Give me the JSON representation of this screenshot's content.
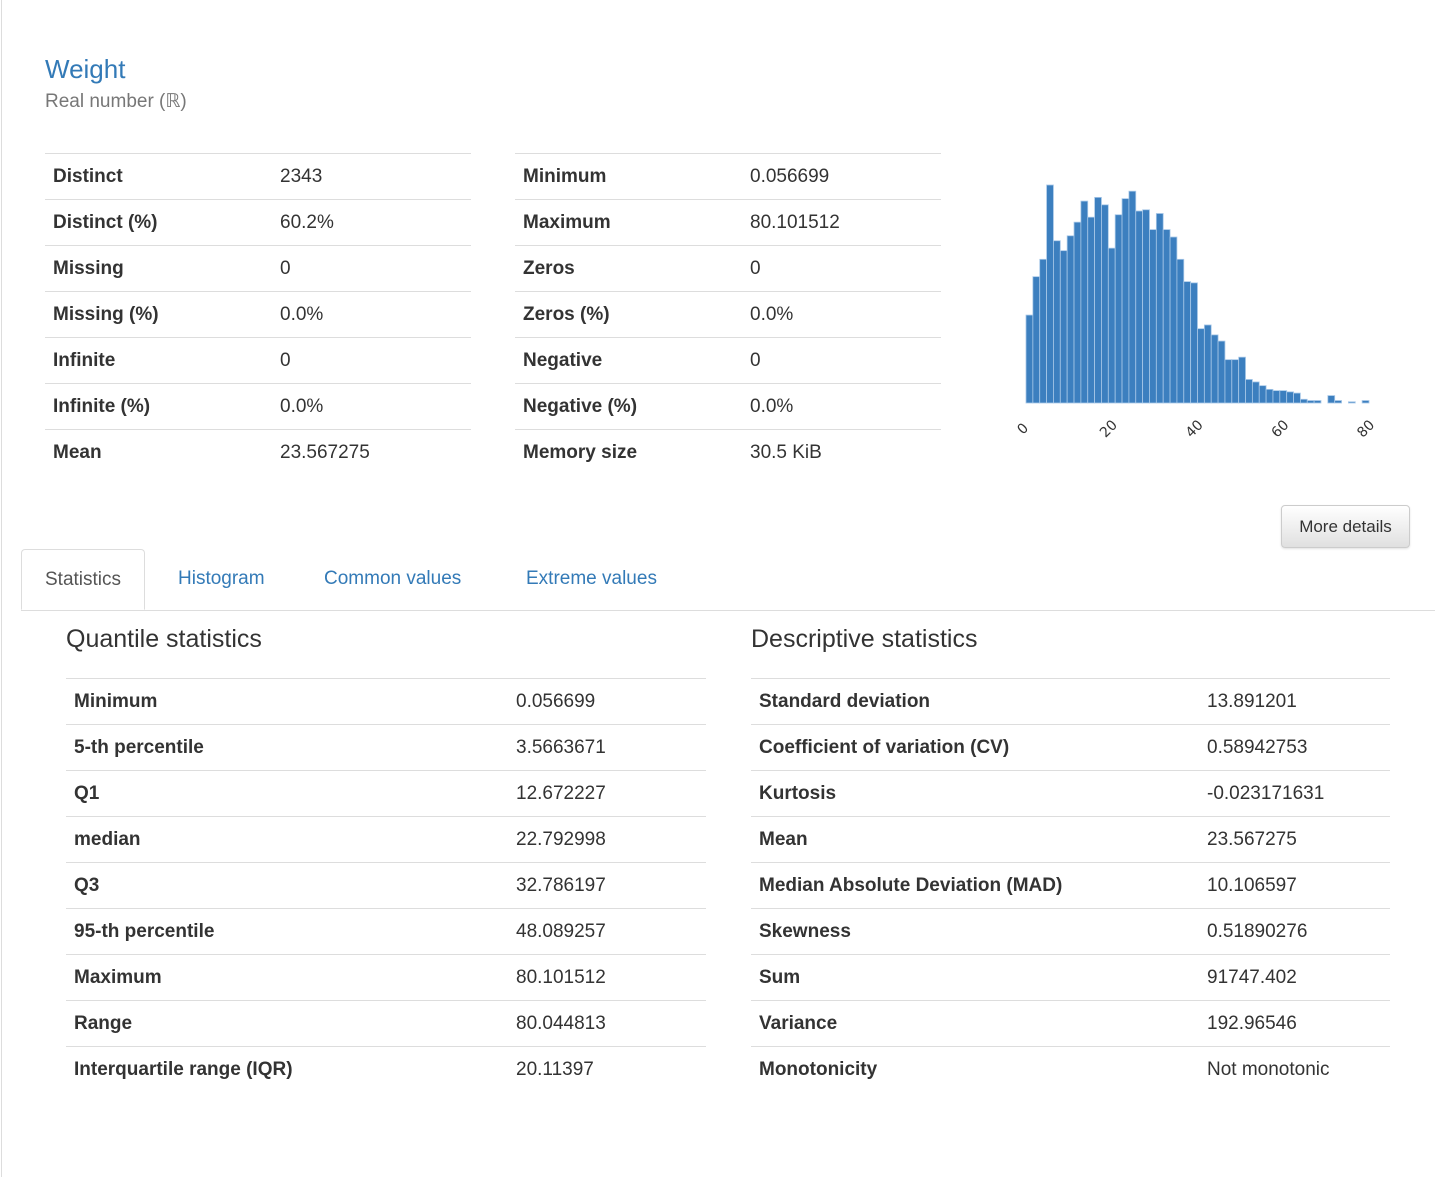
{
  "variable": {
    "name": "Weight",
    "type": "Real number (ℝ)"
  },
  "overview_left": [
    {
      "label": "Distinct",
      "value": "2343"
    },
    {
      "label": "Distinct (%)",
      "value": "60.2%"
    },
    {
      "label": "Missing",
      "value": "0"
    },
    {
      "label": "Missing (%)",
      "value": "0.0%"
    },
    {
      "label": "Infinite",
      "value": "0"
    },
    {
      "label": "Infinite (%)",
      "value": "0.0%"
    },
    {
      "label": "Mean",
      "value": "23.567275"
    }
  ],
  "overview_right": [
    {
      "label": "Minimum",
      "value": "0.056699"
    },
    {
      "label": "Maximum",
      "value": "80.101512"
    },
    {
      "label": "Zeros",
      "value": "0"
    },
    {
      "label": "Zeros (%)",
      "value": "0.0%"
    },
    {
      "label": "Negative",
      "value": "0"
    },
    {
      "label": "Negative (%)",
      "value": "0.0%"
    },
    {
      "label": "Memory size",
      "value": "30.5 KiB"
    }
  ],
  "more_details_label": "More details",
  "tabs": [
    {
      "label": "Statistics",
      "active": true
    },
    {
      "label": "Histogram",
      "active": false
    },
    {
      "label": "Common values",
      "active": false
    },
    {
      "label": "Extreme values",
      "active": false
    }
  ],
  "quantile": {
    "title": "Quantile statistics",
    "rows": [
      {
        "label": "Minimum",
        "value": "0.056699"
      },
      {
        "label": "5-th percentile",
        "value": "3.5663671"
      },
      {
        "label": "Q1",
        "value": "12.672227"
      },
      {
        "label": "median",
        "value": "22.792998"
      },
      {
        "label": "Q3",
        "value": "32.786197"
      },
      {
        "label": "95-th percentile",
        "value": "48.089257"
      },
      {
        "label": "Maximum",
        "value": "80.101512"
      },
      {
        "label": "Range",
        "value": "80.044813"
      },
      {
        "label": "Interquartile range (IQR)",
        "value": "20.11397"
      }
    ]
  },
  "descriptive": {
    "title": "Descriptive statistics",
    "rows": [
      {
        "label": "Standard deviation",
        "value": "13.891201"
      },
      {
        "label": "Coefficient of variation (CV)",
        "value": "0.58942753"
      },
      {
        "label": "Kurtosis",
        "value": "-0.023171631"
      },
      {
        "label": "Mean",
        "value": "23.567275"
      },
      {
        "label": "Median Absolute Deviation (MAD)",
        "value": "10.106597"
      },
      {
        "label": "Skewness",
        "value": "0.51890276"
      },
      {
        "label": "Sum",
        "value": "91747.402"
      },
      {
        "label": "Variance",
        "value": "192.96546"
      },
      {
        "label": "Monotonicity",
        "value": "Not monotonic"
      }
    ]
  },
  "colors": {
    "accent": "#337ab7",
    "bar_fill": "#3c7fbf",
    "bar_edge": "#a8c8e8"
  },
  "chart_data": {
    "type": "bar",
    "title": "",
    "xlabel": "",
    "ylabel": "",
    "xlim": [
      0,
      80
    ],
    "xticks": [
      "0",
      "20",
      "40",
      "60",
      "80"
    ],
    "xtick_values": [
      0,
      20,
      40,
      60,
      80
    ],
    "bin_count": 50,
    "bin_range": [
      0.056699,
      80.101512
    ],
    "grid": false,
    "legend": "none",
    "values": [
      71,
      102,
      116,
      176,
      131,
      123,
      135,
      146,
      163,
      150,
      166,
      160,
      125,
      152,
      165,
      171,
      155,
      156,
      140,
      153,
      140,
      134,
      116,
      98,
      97,
      60,
      63,
      55,
      50,
      35,
      35,
      37,
      19,
      17,
      14,
      11,
      10,
      10,
      9,
      8,
      3,
      2,
      2,
      0,
      6,
      2,
      0,
      1,
      0,
      2
    ]
  }
}
